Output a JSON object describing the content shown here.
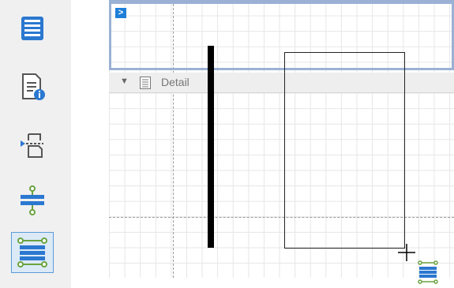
{
  "toolbox": {
    "tools": [
      {
        "name": "report-list-tool",
        "icon": "list-icon"
      },
      {
        "name": "report-info-tool",
        "icon": "document-info-icon"
      },
      {
        "name": "insert-page-tool",
        "icon": "page-break-icon"
      },
      {
        "name": "band-insert-tool",
        "icon": "band-split-icon"
      },
      {
        "name": "band-multiple-tool",
        "icon": "band-group-icon",
        "selected": true
      }
    ]
  },
  "surface": {
    "top_band_toggle": ">",
    "detail_band": {
      "label": "Detail",
      "toggle": "▼"
    }
  },
  "colors": {
    "accent": "#1e7fd8",
    "selection_border": "#9bb1d4",
    "band_header": "#eeeeee",
    "icon_blue": "#2b78d0",
    "icon_green": "#6aa341"
  }
}
